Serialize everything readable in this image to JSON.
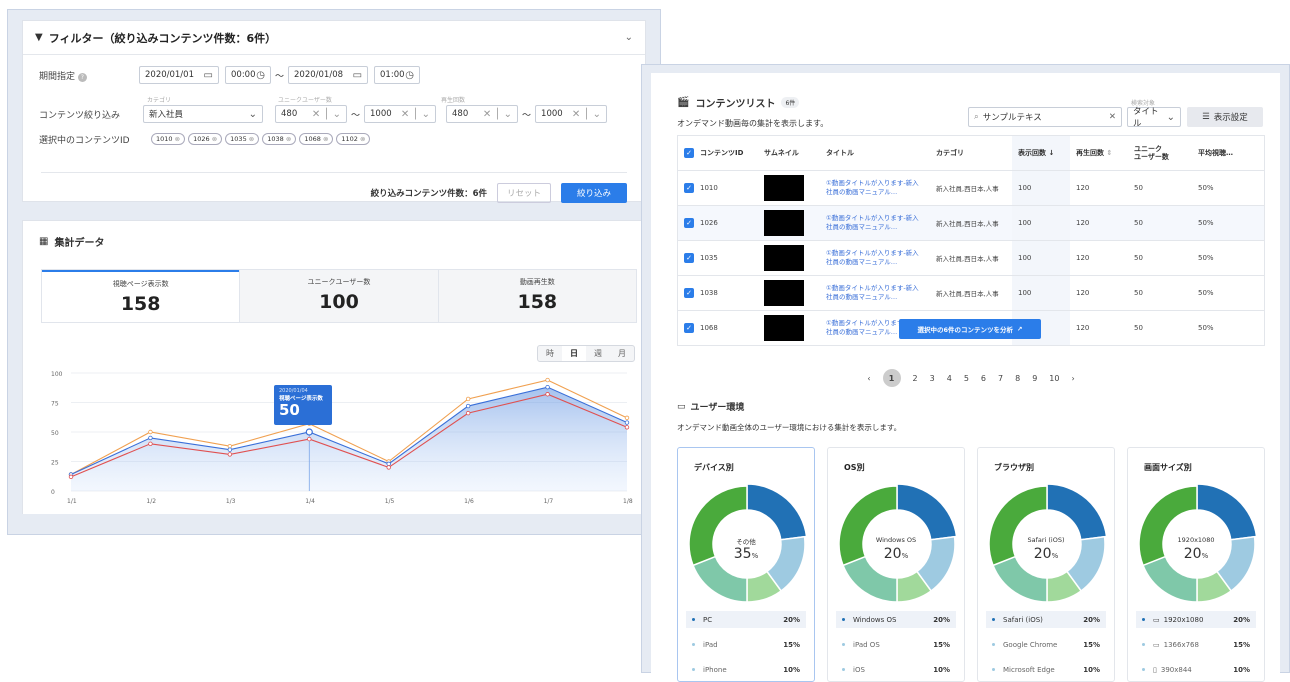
{
  "filter": {
    "title": "フィルター（絞り込みコンテンツ件数：6件）",
    "period_label": "期間指定",
    "start_date": "2020/01/01",
    "start_time": "00:00",
    "tilde": "〜",
    "end_date": "2020/01/08",
    "end_time": "01:00",
    "narrow_label": "コンテンツ絞り込み",
    "category_sub": "カテゴリ",
    "category_value": "新入社員",
    "unique_sub": "ユニークユーザー数",
    "unique_min": "480",
    "unique_max": "1000",
    "play_sub": "再生回数",
    "play_min": "480",
    "play_max": "1000",
    "selected_label": "選択中のコンテンツID",
    "chips": [
      "1010",
      "1026",
      "1035",
      "1038",
      "1068",
      "1102"
    ],
    "count_text": "絞り込みコンテンツ件数：6件",
    "reset_label": "リセット",
    "apply_label": "絞り込み"
  },
  "summary": {
    "title": "集計データ",
    "tiles": [
      {
        "label": "視聴ページ表示数",
        "value": "158"
      },
      {
        "label": "ユニークユーザー数",
        "value": "100"
      },
      {
        "label": "動画再生数",
        "value": "158"
      }
    ],
    "segments": [
      "時",
      "日",
      "週",
      "月"
    ],
    "tooltip_date": "2020/01/04",
    "tooltip_label": "視聴ページ表示数",
    "tooltip_value": "50"
  },
  "chart_data": {
    "type": "line",
    "categories": [
      "1/1",
      "1/2",
      "1/3",
      "1/4",
      "1/5",
      "1/6",
      "1/7",
      "1/8"
    ],
    "ylim": [
      0,
      100
    ],
    "yticks": [
      "0",
      "25",
      "50",
      "75",
      "100"
    ],
    "series": [
      {
        "values": [
          14,
          50,
          38,
          57,
          25,
          78,
          94,
          62
        ],
        "color": "#f0a050"
      },
      {
        "values": [
          14,
          45,
          35,
          50,
          23,
          72,
          88,
          58
        ],
        "color": "#3a6fd8"
      },
      {
        "values": [
          12,
          40,
          31,
          44,
          20,
          66,
          82,
          54
        ],
        "color": "#e05050"
      }
    ]
  },
  "contents": {
    "title": "コンテンツリスト",
    "badge": "6件",
    "desc": "オンデマンド動画毎の集計を表示します。",
    "search_value": "サンプルテキス",
    "search_target_sub": "検索対象",
    "search_target": "タイトル",
    "settings_label": "表示設定",
    "columns": [
      "コンテンツID",
      "サムネイル",
      "タイトル",
      "カテゴリ",
      "表示回数",
      "再生回数",
      "ユニーク\nユーザー数",
      "平均視聴…"
    ],
    "rows": [
      {
        "id": "1010",
        "title": "①動画タイトルが入ります-新入社員の動画マニュアル…",
        "category": "新入社員,西日本,人事",
        "views": "100",
        "plays": "120",
        "users": "50",
        "avg": "50%"
      },
      {
        "id": "1026",
        "title": "①動画タイトルが入ります-新入社員の動画マニュアル…",
        "category": "新入社員,西日本,人事",
        "views": "100",
        "plays": "120",
        "users": "50",
        "avg": "50%"
      },
      {
        "id": "1035",
        "title": "①動画タイトルが入ります-新入社員の動画マニュアル…",
        "category": "新入社員,西日本,人事",
        "views": "100",
        "plays": "120",
        "users": "50",
        "avg": "50%"
      },
      {
        "id": "1038",
        "title": "①動画タイトルが入ります-新入社員の動画マニュアル…",
        "category": "新入社員,西日本,人事",
        "views": "100",
        "plays": "120",
        "users": "50",
        "avg": "50%"
      },
      {
        "id": "1068",
        "title": "①動画タイトルが入ります-新入社員の動画マニュアル…",
        "category": "",
        "views": "100",
        "plays": "120",
        "users": "50",
        "avg": "50%"
      }
    ],
    "analyze_label": "選択中の6件のコンテンツを分析",
    "pages": [
      "1",
      "2",
      "3",
      "4",
      "5",
      "6",
      "7",
      "8",
      "9",
      "10"
    ]
  },
  "environment": {
    "title": "ユーザー環境",
    "desc": "オンデマンド動画全体のユーザー環境における集計を表示します。",
    "cards": [
      {
        "title": "デバイス別",
        "center_label": "その他",
        "center_value": "35",
        "unit": "%",
        "items": [
          {
            "name": "PC",
            "pct": "20%"
          },
          {
            "name": "iPad",
            "pct": "15%"
          },
          {
            "name": "iPhone",
            "pct": "10%"
          }
        ]
      },
      {
        "title": "OS別",
        "center_label": "Windows OS",
        "center_value": "20",
        "unit": "%",
        "items": [
          {
            "name": "Windows OS",
            "pct": "20%"
          },
          {
            "name": "iPad OS",
            "pct": "15%"
          },
          {
            "name": "iOS",
            "pct": "10%"
          }
        ]
      },
      {
        "title": "ブラウザ別",
        "center_label": "Safari (iOS)",
        "center_value": "20",
        "unit": "%",
        "items": [
          {
            "name": "Safari (iOS)",
            "pct": "20%"
          },
          {
            "name": "Google Chrome",
            "pct": "15%"
          },
          {
            "name": "Microsoft Edge",
            "pct": "10%"
          }
        ]
      },
      {
        "title": "画面サイズ別",
        "center_label": "1920x1080",
        "center_value": "20",
        "unit": "%",
        "items": [
          {
            "name": "1920x1080",
            "pct": "20%"
          },
          {
            "name": "1366x768",
            "pct": "15%"
          },
          {
            "name": "390x844",
            "pct": "10%"
          }
        ]
      }
    ]
  }
}
